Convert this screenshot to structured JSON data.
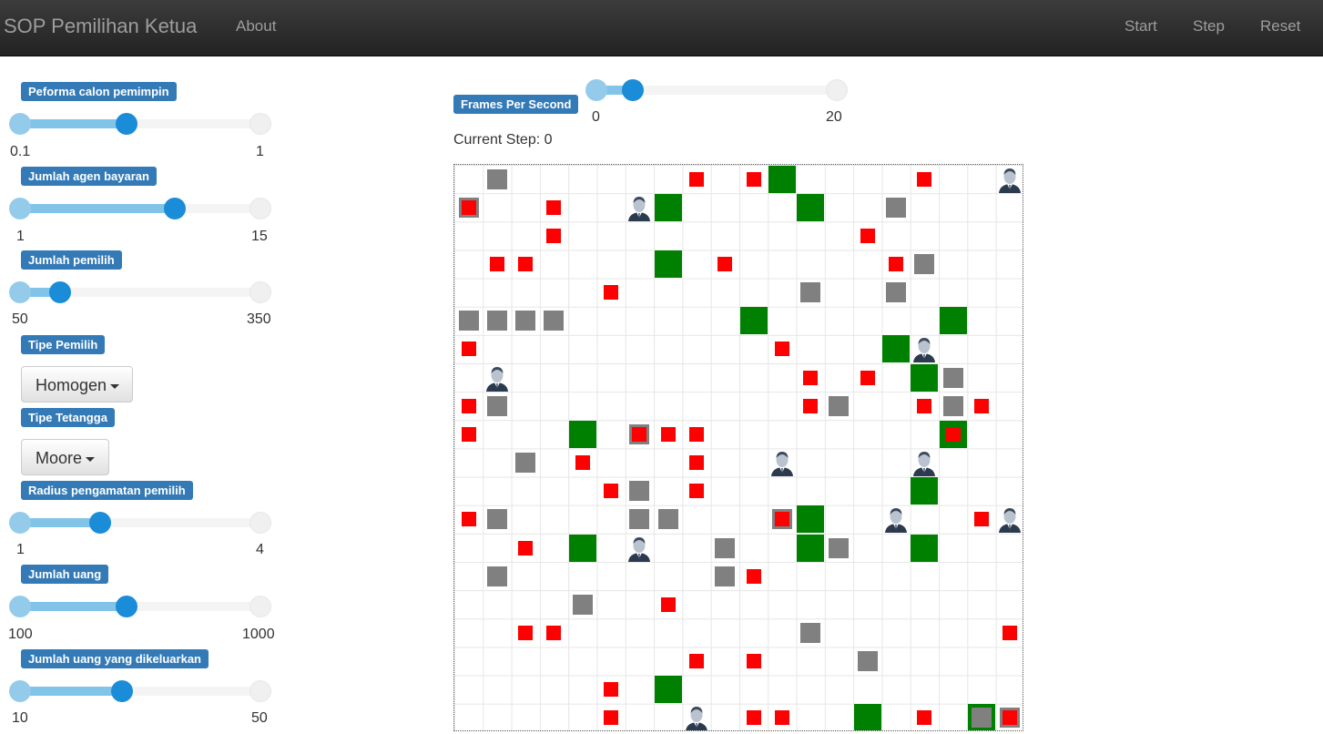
{
  "navbar": {
    "brand": "SOP Pemilihan Ketua",
    "about": "About",
    "start": "Start",
    "step": "Step",
    "reset": "Reset"
  },
  "controls": {
    "performa": {
      "label": "Peforma calon pemimpin",
      "min": "0.1",
      "max": "1",
      "value": 0.5
    },
    "agen_bayaran": {
      "label": "Jumlah agen bayaran",
      "min": "1",
      "max": "15",
      "value": 10
    },
    "pemilih": {
      "label": "Jumlah pemilih",
      "min": "50",
      "max": "350",
      "value": 100
    },
    "tipe_pemilih": {
      "label": "Tipe Pemilih",
      "selected": "Homogen"
    },
    "tipe_tetangga": {
      "label": "Tipe Tetangga",
      "selected": "Moore"
    },
    "radius": {
      "label": "Radius pengamatan pemilih",
      "min": "1",
      "max": "4",
      "value": 2
    },
    "uang": {
      "label": "Jumlah uang",
      "min": "100",
      "max": "1000",
      "value": 500
    },
    "uang_dikeluarkan": {
      "label": "Jumlah uang yang dikeluarkan",
      "min": "10",
      "max": "50",
      "value": 27
    },
    "fps": {
      "label": "Frames Per Second",
      "min": "0",
      "max": "20",
      "value": 3
    }
  },
  "status": {
    "current_step": "Current Step: 0"
  },
  "colors": {
    "red_agent": "#ff0000",
    "gray_agent": "#808080",
    "green_agent": "#008000",
    "label_bg": "#337ab7"
  },
  "grid": {
    "cols": 20,
    "rows": 20,
    "agents": [
      {
        "c": 1,
        "r": 0,
        "t": "gray"
      },
      {
        "c": 8,
        "r": 0,
        "t": "red"
      },
      {
        "c": 10,
        "r": 0,
        "t": "red"
      },
      {
        "c": 11,
        "r": 0,
        "t": "green"
      },
      {
        "c": 16,
        "r": 0,
        "t": "red"
      },
      {
        "c": 19,
        "r": 0,
        "t": "person"
      },
      {
        "c": 0,
        "r": 1,
        "t": "gray"
      },
      {
        "c": 0,
        "r": 1,
        "t": "red"
      },
      {
        "c": 3,
        "r": 1,
        "t": "red"
      },
      {
        "c": 6,
        "r": 1,
        "t": "person"
      },
      {
        "c": 7,
        "r": 1,
        "t": "green"
      },
      {
        "c": 12,
        "r": 1,
        "t": "green"
      },
      {
        "c": 15,
        "r": 1,
        "t": "gray"
      },
      {
        "c": 3,
        "r": 2,
        "t": "red"
      },
      {
        "c": 14,
        "r": 2,
        "t": "red"
      },
      {
        "c": 1,
        "r": 3,
        "t": "red"
      },
      {
        "c": 2,
        "r": 3,
        "t": "red"
      },
      {
        "c": 7,
        "r": 3,
        "t": "green"
      },
      {
        "c": 9,
        "r": 3,
        "t": "red"
      },
      {
        "c": 15,
        "r": 3,
        "t": "red"
      },
      {
        "c": 16,
        "r": 3,
        "t": "gray"
      },
      {
        "c": 5,
        "r": 4,
        "t": "red"
      },
      {
        "c": 12,
        "r": 4,
        "t": "gray"
      },
      {
        "c": 15,
        "r": 4,
        "t": "gray"
      },
      {
        "c": 0,
        "r": 5,
        "t": "gray"
      },
      {
        "c": 1,
        "r": 5,
        "t": "gray"
      },
      {
        "c": 2,
        "r": 5,
        "t": "gray"
      },
      {
        "c": 3,
        "r": 5,
        "t": "gray"
      },
      {
        "c": 10,
        "r": 5,
        "t": "green"
      },
      {
        "c": 17,
        "r": 5,
        "t": "green"
      },
      {
        "c": 0,
        "r": 6,
        "t": "red"
      },
      {
        "c": 11,
        "r": 6,
        "t": "red"
      },
      {
        "c": 15,
        "r": 6,
        "t": "green"
      },
      {
        "c": 16,
        "r": 6,
        "t": "person"
      },
      {
        "c": 1,
        "r": 7,
        "t": "person"
      },
      {
        "c": 12,
        "r": 7,
        "t": "red"
      },
      {
        "c": 14,
        "r": 7,
        "t": "red"
      },
      {
        "c": 16,
        "r": 7,
        "t": "green"
      },
      {
        "c": 17,
        "r": 7,
        "t": "gray"
      },
      {
        "c": 0,
        "r": 8,
        "t": "red"
      },
      {
        "c": 1,
        "r": 8,
        "t": "gray"
      },
      {
        "c": 12,
        "r": 8,
        "t": "red"
      },
      {
        "c": 13,
        "r": 8,
        "t": "gray"
      },
      {
        "c": 16,
        "r": 8,
        "t": "red"
      },
      {
        "c": 17,
        "r": 8,
        "t": "gray"
      },
      {
        "c": 18,
        "r": 8,
        "t": "red"
      },
      {
        "c": 0,
        "r": 9,
        "t": "red"
      },
      {
        "c": 4,
        "r": 9,
        "t": "green"
      },
      {
        "c": 6,
        "r": 9,
        "t": "gray"
      },
      {
        "c": 6,
        "r": 9,
        "t": "red"
      },
      {
        "c": 7,
        "r": 9,
        "t": "red"
      },
      {
        "c": 8,
        "r": 9,
        "t": "red"
      },
      {
        "c": 17,
        "r": 9,
        "t": "green"
      },
      {
        "c": 17,
        "r": 9,
        "t": "red"
      },
      {
        "c": 2,
        "r": 10,
        "t": "gray"
      },
      {
        "c": 4,
        "r": 10,
        "t": "red"
      },
      {
        "c": 8,
        "r": 10,
        "t": "red"
      },
      {
        "c": 11,
        "r": 10,
        "t": "person"
      },
      {
        "c": 16,
        "r": 10,
        "t": "person"
      },
      {
        "c": 5,
        "r": 11,
        "t": "red"
      },
      {
        "c": 6,
        "r": 11,
        "t": "gray"
      },
      {
        "c": 8,
        "r": 11,
        "t": "red"
      },
      {
        "c": 16,
        "r": 11,
        "t": "green"
      },
      {
        "c": 0,
        "r": 12,
        "t": "red"
      },
      {
        "c": 1,
        "r": 12,
        "t": "gray"
      },
      {
        "c": 6,
        "r": 12,
        "t": "gray"
      },
      {
        "c": 7,
        "r": 12,
        "t": "gray"
      },
      {
        "c": 11,
        "r": 12,
        "t": "gray"
      },
      {
        "c": 11,
        "r": 12,
        "t": "red"
      },
      {
        "c": 12,
        "r": 12,
        "t": "green"
      },
      {
        "c": 15,
        "r": 12,
        "t": "person"
      },
      {
        "c": 18,
        "r": 12,
        "t": "red"
      },
      {
        "c": 19,
        "r": 12,
        "t": "person"
      },
      {
        "c": 2,
        "r": 13,
        "t": "red"
      },
      {
        "c": 4,
        "r": 13,
        "t": "green"
      },
      {
        "c": 6,
        "r": 13,
        "t": "person"
      },
      {
        "c": 9,
        "r": 13,
        "t": "gray"
      },
      {
        "c": 12,
        "r": 13,
        "t": "green"
      },
      {
        "c": 13,
        "r": 13,
        "t": "gray"
      },
      {
        "c": 16,
        "r": 13,
        "t": "green"
      },
      {
        "c": 1,
        "r": 14,
        "t": "gray"
      },
      {
        "c": 9,
        "r": 14,
        "t": "gray"
      },
      {
        "c": 10,
        "r": 14,
        "t": "red"
      },
      {
        "c": 4,
        "r": 15,
        "t": "gray"
      },
      {
        "c": 7,
        "r": 15,
        "t": "red"
      },
      {
        "c": 2,
        "r": 16,
        "t": "red"
      },
      {
        "c": 3,
        "r": 16,
        "t": "red"
      },
      {
        "c": 12,
        "r": 16,
        "t": "gray"
      },
      {
        "c": 19,
        "r": 16,
        "t": "red"
      },
      {
        "c": 8,
        "r": 17,
        "t": "red"
      },
      {
        "c": 10,
        "r": 17,
        "t": "red"
      },
      {
        "c": 14,
        "r": 17,
        "t": "gray"
      },
      {
        "c": 5,
        "r": 18,
        "t": "red"
      },
      {
        "c": 7,
        "r": 18,
        "t": "green"
      },
      {
        "c": 5,
        "r": 19,
        "t": "red"
      },
      {
        "c": 8,
        "r": 19,
        "t": "person"
      },
      {
        "c": 10,
        "r": 19,
        "t": "red"
      },
      {
        "c": 11,
        "r": 19,
        "t": "red"
      },
      {
        "c": 14,
        "r": 19,
        "t": "green"
      },
      {
        "c": 16,
        "r": 19,
        "t": "red"
      },
      {
        "c": 18,
        "r": 19,
        "t": "green"
      },
      {
        "c": 18,
        "r": 19,
        "t": "gray"
      },
      {
        "c": 19,
        "r": 19,
        "t": "gray"
      },
      {
        "c": 19,
        "r": 19,
        "t": "red"
      }
    ]
  }
}
